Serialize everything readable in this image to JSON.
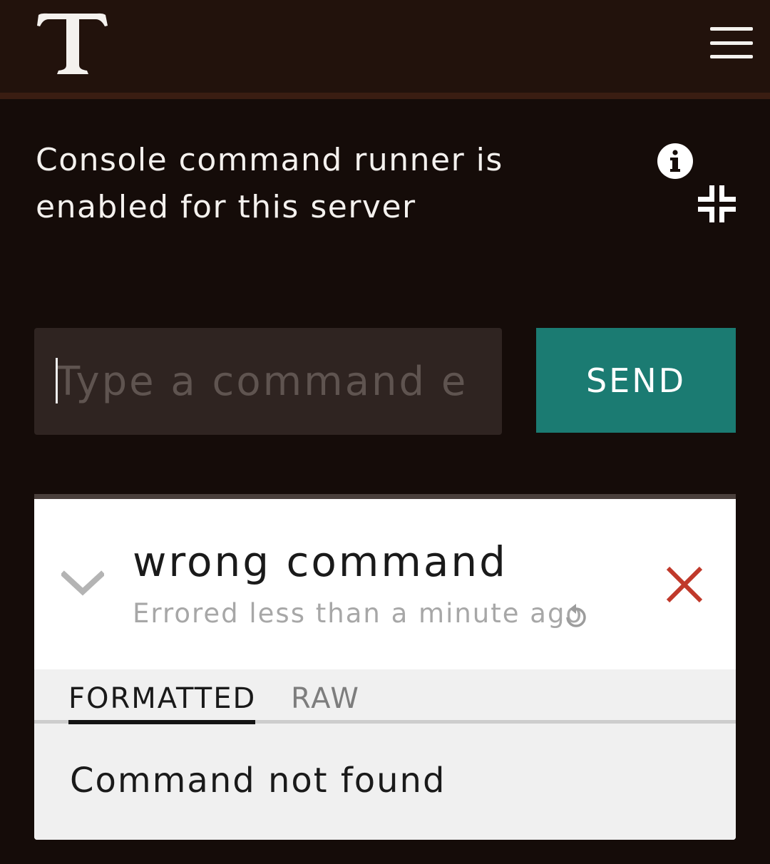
{
  "header": {
    "logo_icon": "serif-letter-t-logo",
    "logo_letter": "T",
    "menu_icon": "hamburger-menu-icon"
  },
  "notice": {
    "text": "Console command runner is enabled for this server",
    "info_icon": "info-icon",
    "collapse_icon": "collapse-fullscreen-icon"
  },
  "command_input": {
    "value": "",
    "placeholder": "Type a command e"
  },
  "send_button": {
    "label": "SEND"
  },
  "result_card": {
    "command": "wrong command",
    "status": "Errored less than a minute ago",
    "expand_icon": "chevron-down-icon",
    "rerun_icon": "rerun-icon",
    "close_icon": "close-icon",
    "tabs": [
      {
        "label": "FORMATTED",
        "active": true
      },
      {
        "label": "RAW",
        "active": false
      }
    ],
    "output": "Command not found"
  },
  "colors": {
    "background": "#150c09",
    "header": "#22120c",
    "accent": "#1b7b72",
    "error": "#c0392b"
  }
}
